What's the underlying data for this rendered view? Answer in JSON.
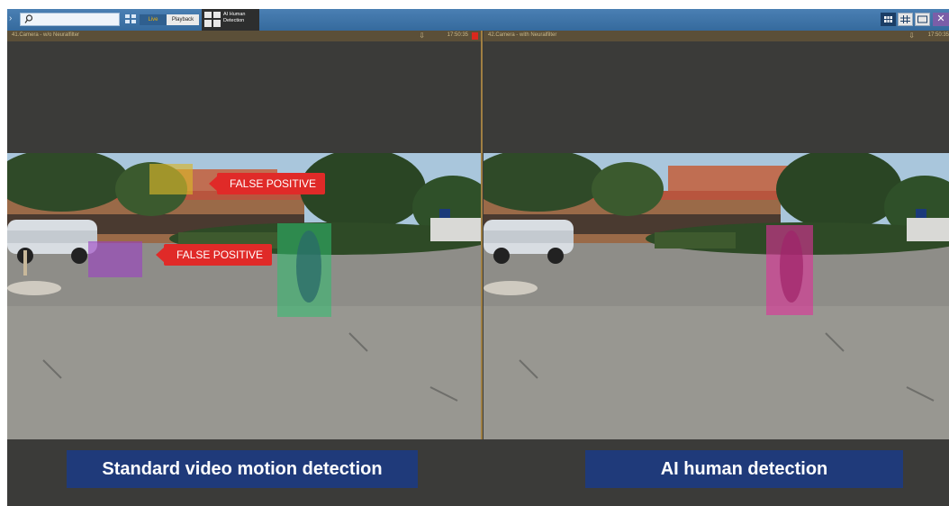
{
  "toolbar": {
    "live_label": "Live",
    "playback_label": "Playback",
    "tab_label": "AI Human Detection"
  },
  "panels": {
    "left": {
      "camera_name": "41.Camera - w/o Neuralfilter",
      "timestamp": "17:50:35"
    },
    "right": {
      "camera_name": "42.Camera - with Neuralfilter",
      "timestamp": "17:50:35"
    }
  },
  "overlays": {
    "fp_label_1": "FALSE POSITIVE",
    "fp_label_2": "FALSE POSITIVE"
  },
  "captions": {
    "left": "Standard video motion detection",
    "right": "AI human detection"
  },
  "colors": {
    "caption_bg": "#1f3a7a",
    "false_positive": "#e02a28",
    "motion_box_green": "#2fbf6f",
    "motion_box_purple": "#9b3fc4",
    "motion_box_yellow": "#d8b62a",
    "ai_box_pink": "#e0309a"
  }
}
